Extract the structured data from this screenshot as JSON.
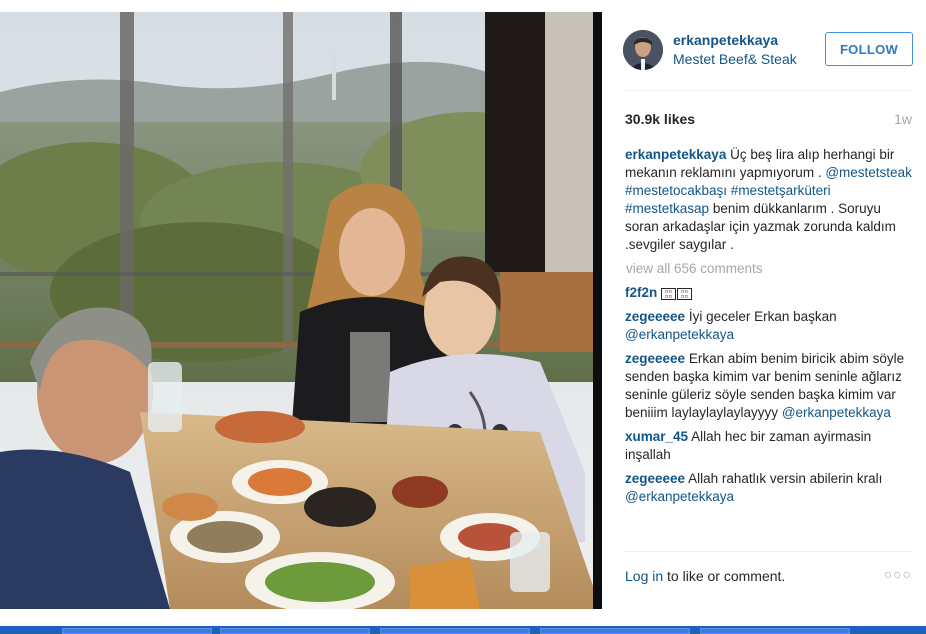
{
  "post": {
    "username": "erkanpetekkaya",
    "location": "Mestet Beef& Steak",
    "follow_label": "FOLLOW",
    "likes": "30.9k likes",
    "time_ago": "1w"
  },
  "caption": {
    "user": "erkanpetekkaya",
    "text1": "Üç beş lira alıp herhangi bir mekanın reklamını yapmıyorum .",
    "tags": "@mestetsteak #mestetocakbaşı #mestetşarküteri #mestetkasap",
    "text2": "benim dükkanlarım . Soruyu soran arkadaşlar için yazmak zorunda kaldım .sevgiler saygılar ."
  },
  "view_all": "view all 656 comments",
  "comments": [
    {
      "user": "f2f2n",
      "text": ""
    },
    {
      "user": "zegeeeee",
      "text": "İyi geceler Erkan başkan",
      "mention": "@erkanpetekkaya"
    },
    {
      "user": "zegeeeee",
      "text": "Erkan abim benim biricik abim söyle senden başka kimim var benim seninle ağlarız seninle güleriz söyle senden başka kimim var beniiim laylaylaylaylayyyy",
      "mention": "@erkanpetekkaya"
    },
    {
      "user": "xumar_45",
      "text": "Allah hec bir zaman ayirmasin inşallah"
    },
    {
      "user": "zegeeeee",
      "text": "Allah rahatlık versin abilerin kralı",
      "mention": "@erkanpetekkaya"
    }
  ],
  "footer": {
    "login_link": "Log in",
    "login_rest": " to like or comment.",
    "more": "○○○"
  },
  "colors": {
    "link": "#125688",
    "follow_border": "#4090db",
    "muted": "#a5a7aa"
  }
}
